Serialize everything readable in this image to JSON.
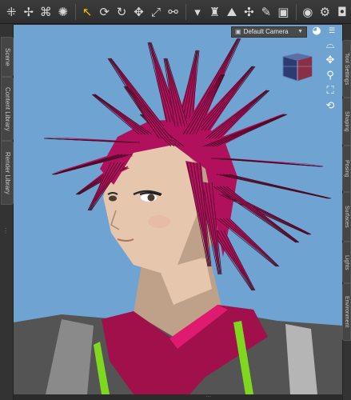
{
  "toolbar": {
    "buttons": [
      {
        "name": "node-selection-tool-icon",
        "glyph": "⁜",
        "active": false
      },
      {
        "name": "universal-tool-icon",
        "glyph": "✢",
        "active": false
      },
      {
        "name": "scene-tool-icon",
        "glyph": "⌘",
        "active": false
      },
      {
        "name": "surface-selection-tool-icon",
        "glyph": "✺",
        "active": false
      },
      {
        "name": "pointer-tool-icon",
        "glyph": "↖",
        "active": true
      },
      {
        "name": "rotate-tool-icon",
        "glyph": "⟳",
        "active": false
      },
      {
        "name": "twist-tool-icon",
        "glyph": "↻",
        "active": false
      },
      {
        "name": "translate-tool-icon",
        "glyph": "✥",
        "active": false
      },
      {
        "name": "scale-tool-icon",
        "glyph": "⤢",
        "active": false
      },
      {
        "name": "joint-editor-tool-icon",
        "glyph": "⚯",
        "active": false
      },
      {
        "name": "filter-icon",
        "glyph": "▾",
        "active": false
      },
      {
        "name": "figure-tool-icon",
        "glyph": "♜",
        "active": false
      },
      {
        "name": "landscape-tool-icon",
        "glyph": "⛰",
        "active": false
      },
      {
        "name": "geometry-editor-icon",
        "glyph": "✣",
        "active": false
      },
      {
        "name": "region-navigator-icon",
        "glyph": "✎",
        "active": false
      },
      {
        "name": "node-weight-icon",
        "glyph": "▣",
        "active": false
      },
      {
        "name": "render-icon",
        "glyph": "◉",
        "active": false
      },
      {
        "name": "render-settings-icon",
        "glyph": "⚙",
        "active": false
      },
      {
        "name": "camera-render-icon",
        "glyph": "◘",
        "active": false
      }
    ]
  },
  "left_tabs": [
    "Scene",
    "Content Library",
    "Render Library"
  ],
  "right_tabs": [
    "Tool Settings",
    "Shaping",
    "Posing",
    "Surfaces",
    "Lights",
    "Environment"
  ],
  "viewport": {
    "camera_label": "Default Camera",
    "background_color": "#6fa3d1",
    "nav_icons": [
      "camera-orbit-icon",
      "pan-icon",
      "zoom-icon",
      "frame-icon",
      "undo-view-icon"
    ]
  },
  "colors": {
    "hair": "#b0105c",
    "hair_dark": "#4a0a26",
    "skin": "#e6c7ad",
    "skin_shadow": "#bfa089",
    "outfit_pink": "#a0104a",
    "outfit_gray": "#545454",
    "outfit_green": "#7fd81f"
  }
}
